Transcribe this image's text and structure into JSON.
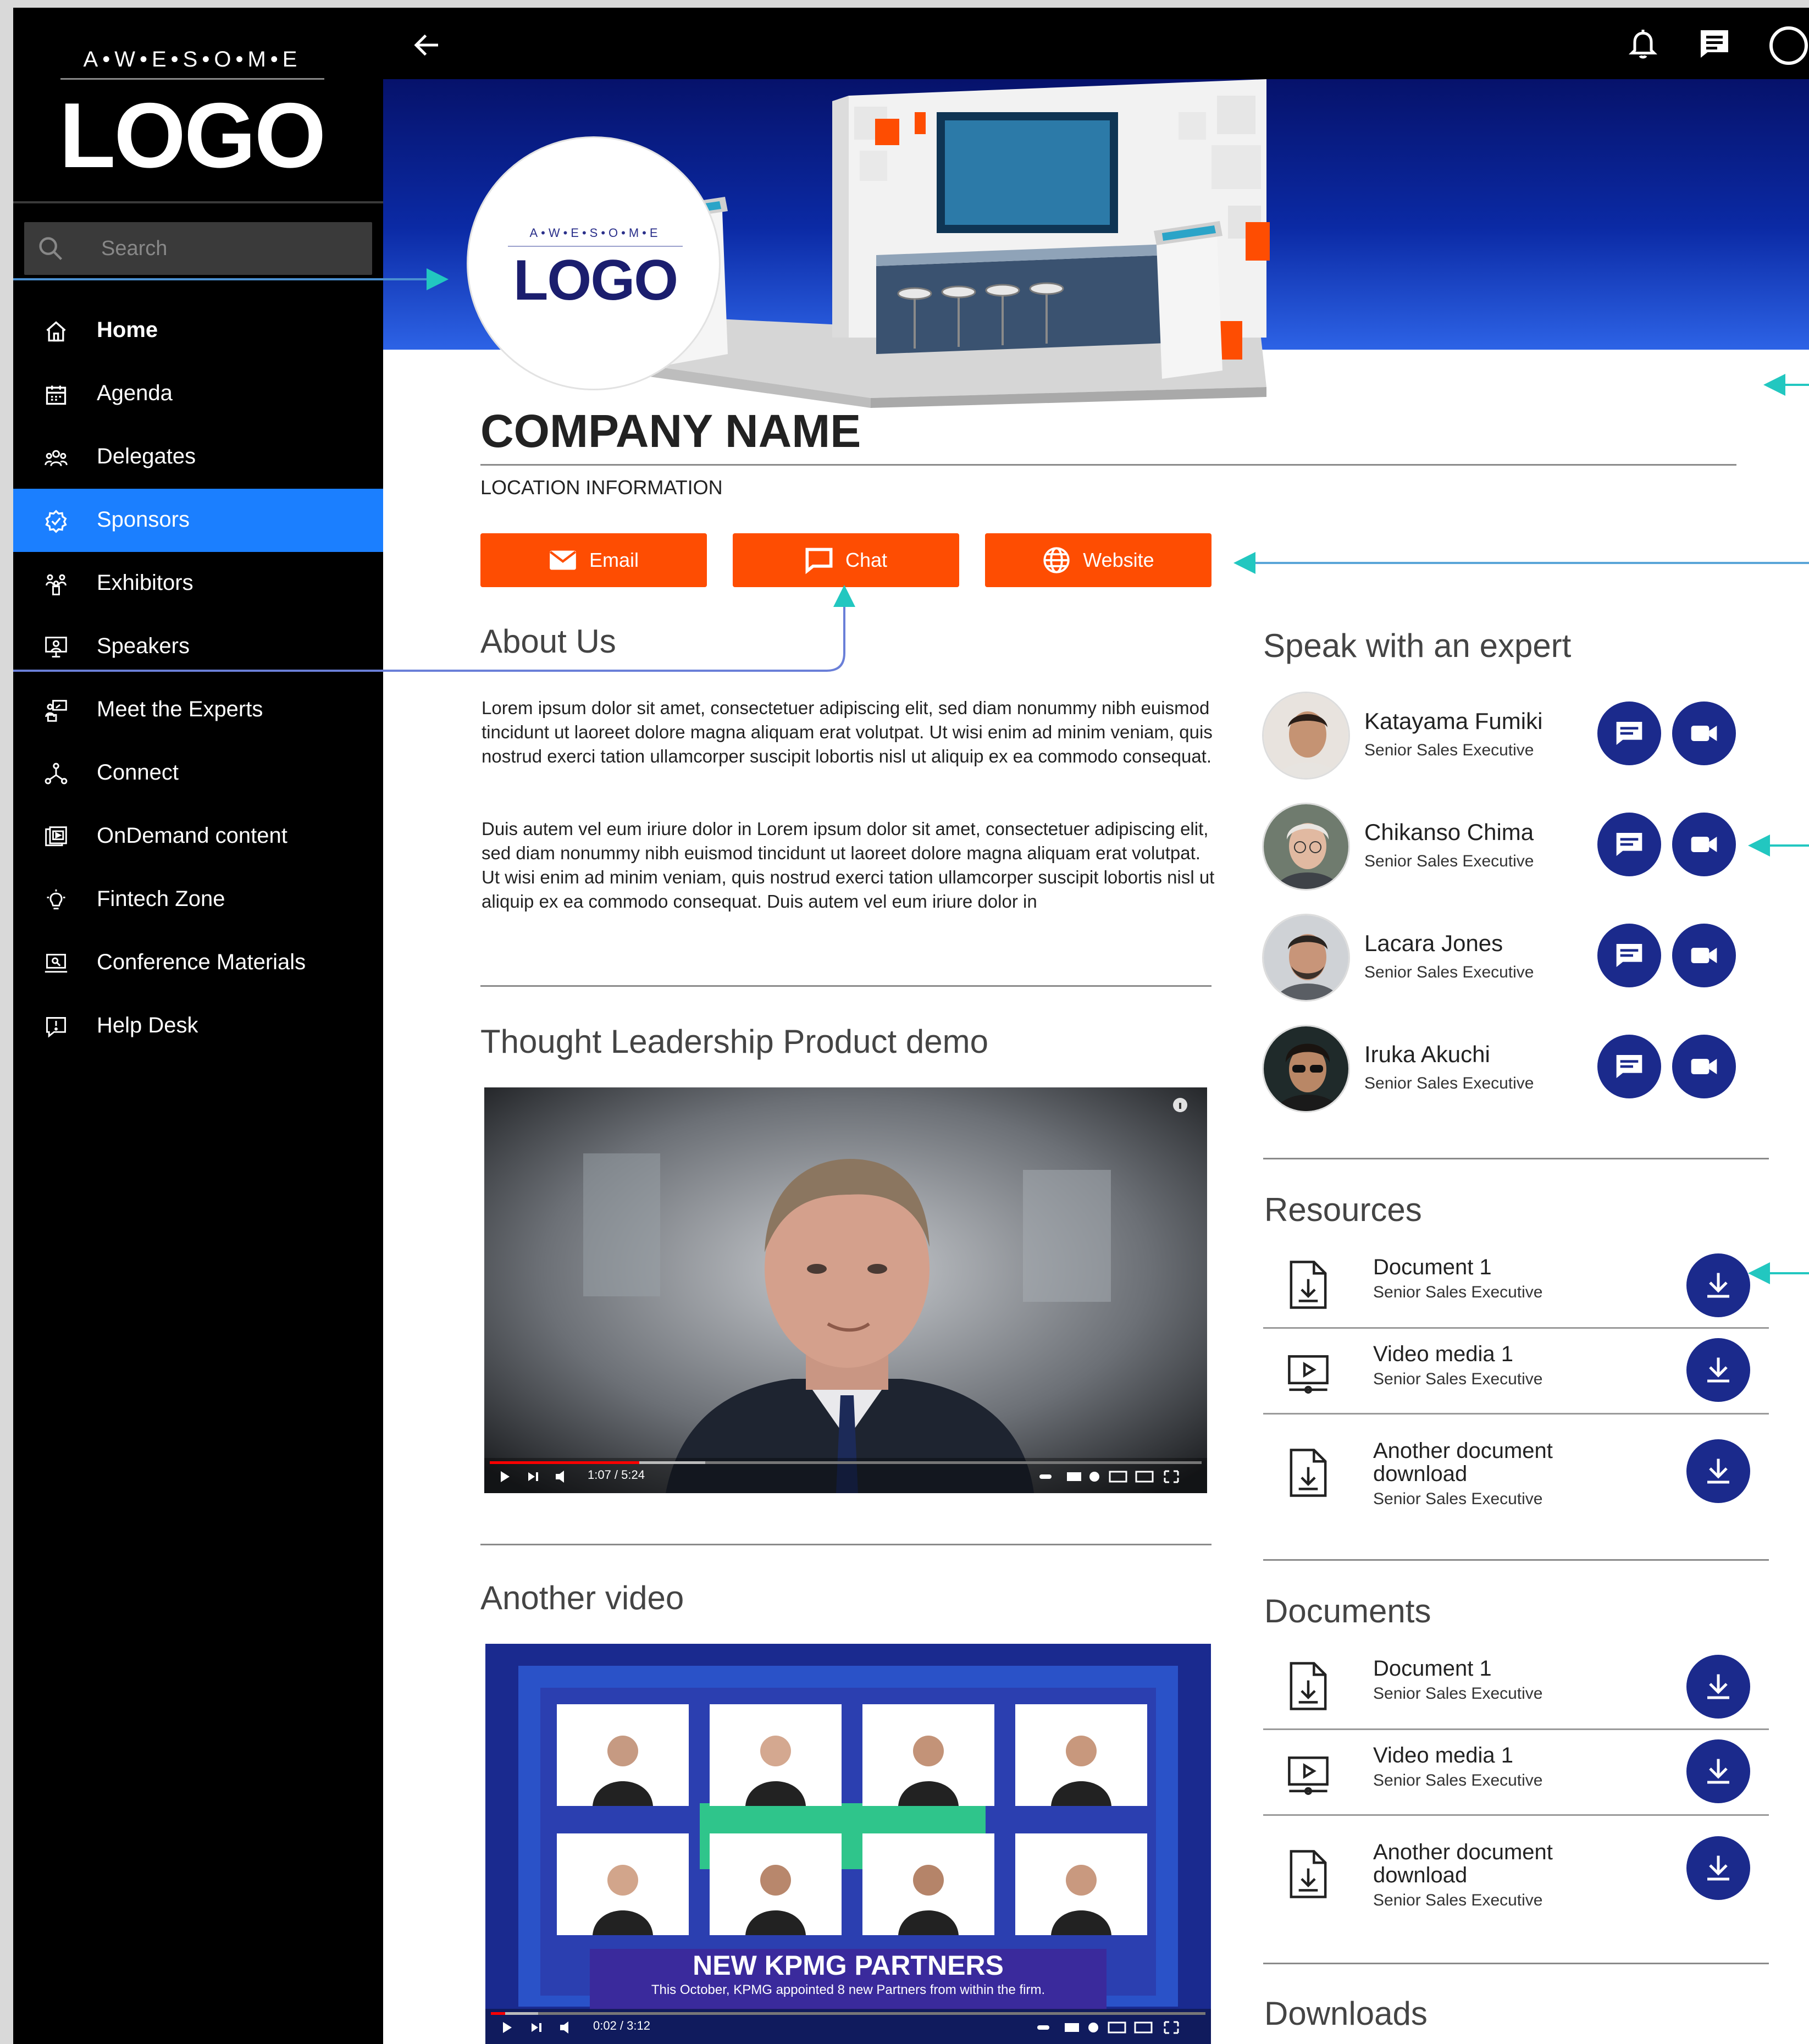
{
  "sidebar": {
    "logo_tagline": "A•W•E•S•O•M•E",
    "logo_word": "LOGO",
    "search_placeholder": "Search",
    "items": [
      {
        "label": "Home",
        "icon": "home-icon",
        "active": false
      },
      {
        "label": "Agenda",
        "icon": "calendar-icon",
        "active": false
      },
      {
        "label": "Delegates",
        "icon": "people-icon",
        "active": false
      },
      {
        "label": "Sponsors",
        "icon": "badge-icon",
        "active": true
      },
      {
        "label": "Exhibitors",
        "icon": "group-icon",
        "active": false
      },
      {
        "label": "Speakers",
        "icon": "presenter-icon",
        "active": false
      },
      {
        "label": "Meet the Experts",
        "icon": "lectern-icon",
        "active": false
      },
      {
        "label": "Connect",
        "icon": "network-icon",
        "active": false
      },
      {
        "label": "OnDemand content",
        "icon": "media-library-icon",
        "active": false
      },
      {
        "label": "Fintech Zone",
        "icon": "bulb-icon",
        "active": false
      },
      {
        "label": "Conference Materials",
        "icon": "laptop-icon",
        "active": false
      },
      {
        "label": "Help Desk",
        "icon": "help-chat-icon",
        "active": false
      }
    ]
  },
  "topbar": {
    "icons": [
      "back-arrow-icon",
      "bell-icon",
      "message-icon",
      "profile-icon"
    ]
  },
  "sponsor": {
    "logo_tagline": "A•W•E•S•O•M•E",
    "logo_word": "LOGO",
    "company_name": "COMPANY NAME",
    "location": "LOCATION INFORMATION",
    "buttons": {
      "email": "Email",
      "chat": "Chat",
      "website": "Website"
    }
  },
  "about": {
    "title": "About Us",
    "paragraphs": [
      "Lorem ipsum dolor sit amet, consectetuer adipiscing elit, sed diam nonummy nibh euismod tincidunt ut laoreet dolore magna aliquam erat volutpat. Ut wisi enim ad minim veniam, quis nostrud exerci tation ullamcorper suscipit lobortis nisl ut aliquip ex ea commodo consequat.",
      "Duis autem vel eum iriure dolor in Lorem ipsum dolor sit amet, consectetuer adipiscing elit, sed diam nonummy nibh euismod tincidunt ut laoreet dolore magna aliquam erat volutpat. Ut wisi enim ad minim veniam, quis nostrud exerci tation ullamcorper suscipit lobortis nisl ut aliquip ex ea commodo consequat. Duis autem vel eum iriure dolor in"
    ]
  },
  "video1": {
    "title": "Thought Leadership Product demo",
    "time": "1:07 / 5:24",
    "progress": 0.21
  },
  "video2": {
    "title": "Another video",
    "headline": "NEW KPMG PARTNERS",
    "caption": "This October, KPMG appointed 8 new Partners from within the firm.",
    "time": "0:02 / 3:12",
    "progress": 0.02
  },
  "experts": {
    "title": "Speak with an expert",
    "people": [
      {
        "name": "Katayama Fumiki",
        "role": "Senior Sales Executive"
      },
      {
        "name": "Chikanso Chima",
        "role": "Senior Sales Executive"
      },
      {
        "name": "Lacara Jones",
        "role": "Senior Sales Executive"
      },
      {
        "name": "Iruka Akuchi",
        "role": "Senior Sales Executive"
      }
    ]
  },
  "resources": {
    "title": "Resources",
    "items": [
      {
        "title": "Document 1",
        "sub": "Senior Sales Executive",
        "icon": "document-download-icon"
      },
      {
        "title": "Video media 1",
        "sub": "Senior Sales Executive",
        "icon": "video-media-icon"
      },
      {
        "title": "Another document download",
        "sub": "Senior Sales Executive",
        "icon": "document-download-icon"
      }
    ]
  },
  "documents": {
    "title": "Documents",
    "items": [
      {
        "title": "Document 1",
        "sub": "Senior Sales Executive",
        "icon": "document-download-icon"
      },
      {
        "title": "Video media 1",
        "sub": "Senior Sales Executive",
        "icon": "video-media-icon"
      },
      {
        "title": "Another document download",
        "sub": "Senior Sales Executive",
        "icon": "document-download-icon"
      }
    ]
  },
  "downloads": {
    "title": "Downloads"
  },
  "colors": {
    "accent_orange": "#fe4d02",
    "nav_active": "#1b7fff",
    "round_button": "#1b2a8c",
    "annotation": "#22c7c0"
  }
}
